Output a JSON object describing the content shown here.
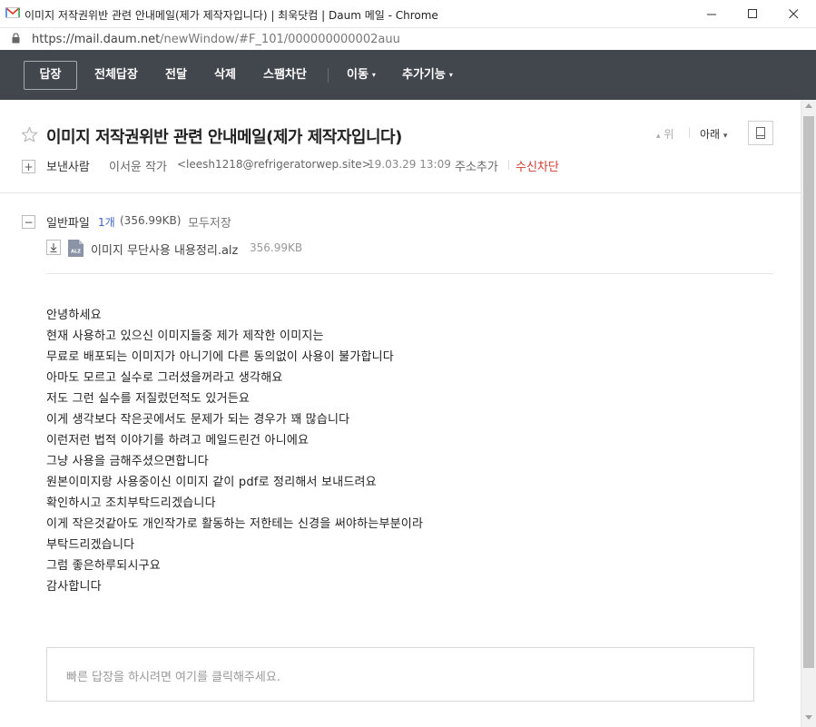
{
  "window": {
    "title": "이미지 저작권위반 관련 안내메일(제가 제작자입니다) | 최욱닷컴 | Daum 메일 - Chrome",
    "url_host": "https://mail.daum.net",
    "url_path": "/newWindow/#F_101/000000000002auu"
  },
  "toolbar": {
    "reply": "답장",
    "reply_all": "전체답장",
    "forward": "전달",
    "delete": "삭제",
    "spam_block": "스팸차단",
    "move": "이동",
    "more": "추가기능"
  },
  "header": {
    "subject": "이미지 저작권위반 관련 안내메일(제가 제작자입니다)",
    "nav_up": "위",
    "nav_down": "아래",
    "sender_label": "보낸사람",
    "sender_name": "이서윤 작가",
    "sender_email": "<leesh1218@refrigeratorwep.site>",
    "date": "19.03.29 13:09",
    "add_contact": "주소추가",
    "block_sender": "수신차단"
  },
  "attachments": {
    "label": "일반파일",
    "count": "1개",
    "total_size": "(356.99KB)",
    "save_all": "모두저장",
    "files": [
      {
        "type_badge": "ALZ",
        "name": "이미지 무단사용 내용정리.alz",
        "size": "356.99KB"
      }
    ]
  },
  "body": {
    "lines": [
      "안녕하세요",
      "현재 사용하고 있으신 이미지들중 제가 제작한 이미지는",
      "무료로 배포되는 이미지가 아니기에 다른 동의없이 사용이 불가합니다",
      "아마도 모르고 실수로 그러셨을꺼라고 생각해요",
      "저도 그런 실수를 저질렀던적도 있거든요",
      "이게 생각보다 작은곳에서도 문제가 되는 경우가 꽤 많습니다",
      "이런저런 법적 이야기를 하려고 메일드린건 아니에요",
      "그냥 사용을 금해주셨으면합니다",
      "원본이미지랑 사용중이신 이미지 같이 pdf로 정리해서 보내드려요",
      "확인하시고 조치부탁드리겠습니다",
      "이게 작은것같아도 개인작가로 활동하는 저한테는 신경을 써야하는부분이라",
      "부탁드리겠습니다",
      "그럼 좋은하루되시구요",
      "감사합니다"
    ]
  },
  "quick_reply": {
    "placeholder": "빠른 답장을 하시려면 여기를 클릭해주세요."
  },
  "icons": {
    "caret": "▾",
    "nav_up_arrow": "▴",
    "nav_down_arrow": "▾",
    "plus": "+",
    "minus": "−",
    "minimize": "—",
    "close": "✕"
  },
  "colors": {
    "toolbar_bg": "#42464d",
    "link_blue": "#3b63c4",
    "block_red": "#d43b32"
  }
}
